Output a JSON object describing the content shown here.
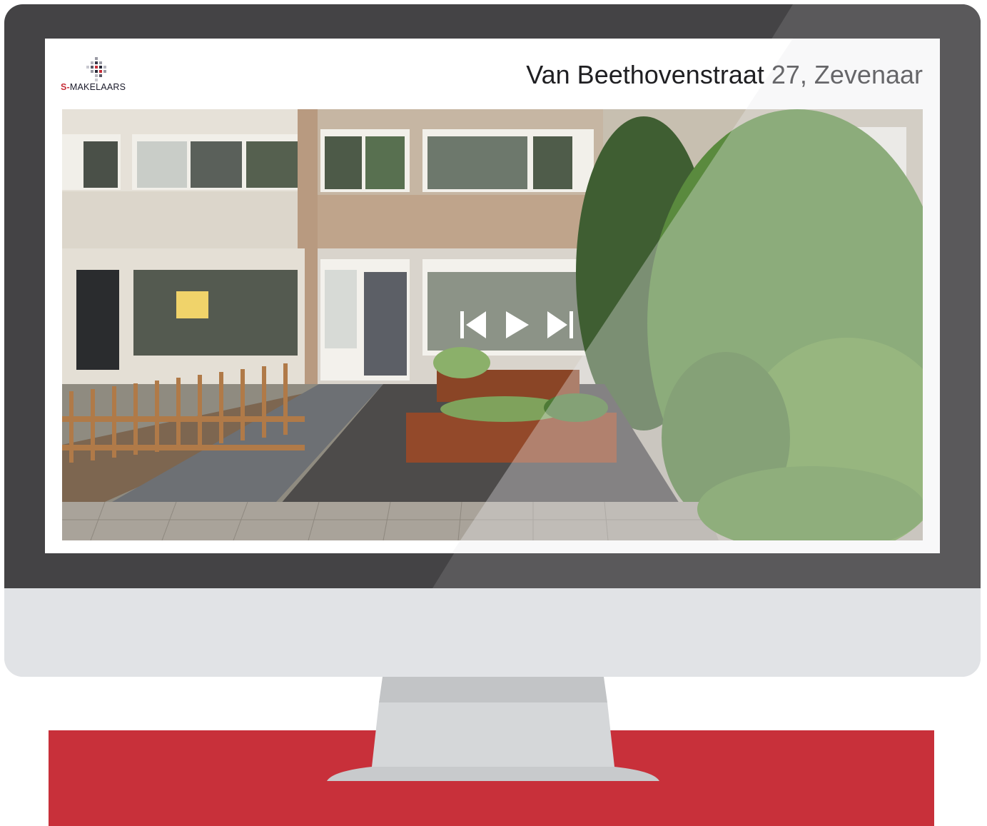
{
  "brand": {
    "logo_text_prefix": "S-",
    "logo_text_rest": "MAKELAARS",
    "accent_color": "#c8303a",
    "logo_icon": "pixel-grid-logo-icon"
  },
  "page": {
    "title": "Van Beethovenstraat 27, Zevenaar"
  },
  "slideshow": {
    "controls": [
      {
        "name": "previous",
        "icon": "skip-back-icon"
      },
      {
        "name": "play",
        "icon": "play-icon"
      },
      {
        "name": "next",
        "icon": "skip-forward-icon"
      }
    ],
    "photo_subject": "house-front-facade"
  },
  "colors": {
    "bezel": "#444345",
    "chin": "#e1e3e6",
    "band": "#c8303a"
  }
}
